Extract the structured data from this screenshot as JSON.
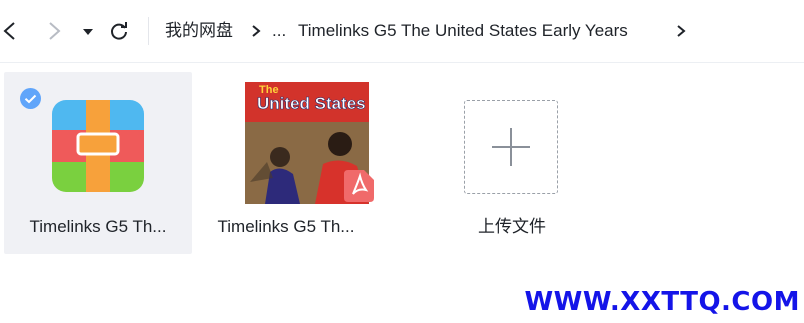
{
  "toolbar": {
    "icons": [
      "back-icon",
      "forward-icon",
      "dropdown-icon",
      "refresh-icon"
    ],
    "breadcrumb": [
      {
        "label": "我的网盘"
      },
      {
        "label": "..."
      },
      {
        "label": "Timelinks G5 The United States Early Years"
      }
    ]
  },
  "files": [
    {
      "name": "Timelinks G5 Th...",
      "type": "archive",
      "selected": true,
      "icon": "archive-icon"
    },
    {
      "name": "Timelinks G5 Th...",
      "type": "pdf",
      "selected": false,
      "icon": "pdf-badge-icon",
      "cover_title": "United States",
      "cover_prefix": "The"
    }
  ],
  "upload": {
    "label": "上传文件",
    "icon": "plus-icon"
  },
  "watermark": "WWW.XXTTQ.COM",
  "colors": {
    "accent": "#60a5fa",
    "watermark": "#1414e8",
    "pdf_red": "#f06a6a"
  }
}
